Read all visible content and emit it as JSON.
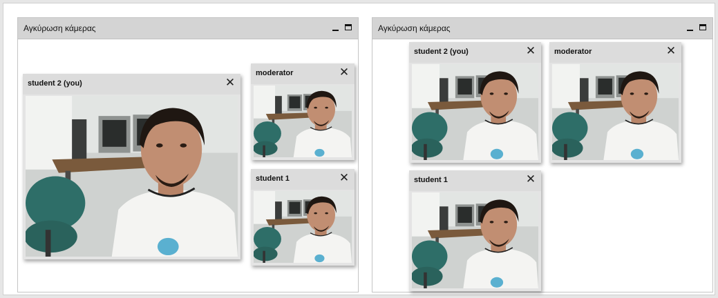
{
  "windows": [
    {
      "title": "Αγκύρωση κάμερας",
      "feeds": [
        {
          "name": "student 2 (you)"
        },
        {
          "name": "moderator"
        },
        {
          "name": "student 1"
        }
      ]
    },
    {
      "title": "Αγκύρωση κάμερας",
      "feeds": [
        {
          "name": "student 2 (you)"
        },
        {
          "name": "moderator"
        },
        {
          "name": "student 1"
        }
      ]
    }
  ],
  "icons": {
    "minimize": "minimize-icon",
    "maximize": "maximize-icon",
    "close": "close-icon"
  },
  "close_glyph": "✕"
}
